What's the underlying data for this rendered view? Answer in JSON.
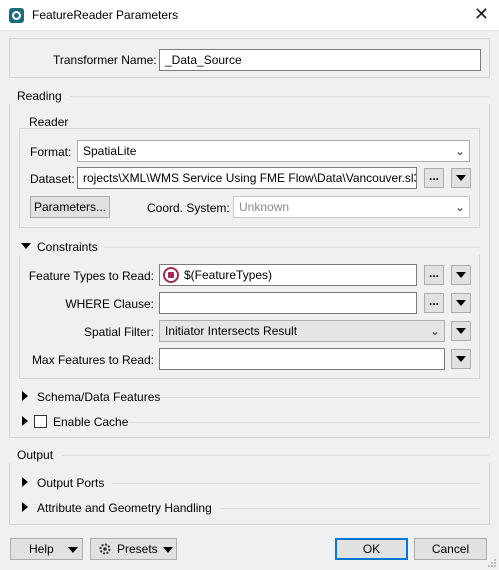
{
  "window": {
    "title": "FeatureReader Parameters",
    "close_glyph": "✕"
  },
  "transformer": {
    "label": "Transformer Name:",
    "value": "_Data_Source"
  },
  "reading": {
    "title": "Reading",
    "reader": {
      "title": "Reader",
      "format_label": "Format:",
      "format_value": "SpatiaLite",
      "dataset_label": "Dataset:",
      "dataset_value": "rojects\\XML\\WMS Service Using FME Flow\\Data\\Vancouver.sl3\"",
      "parameters_button": "Parameters...",
      "coord_label": "Coord. System:",
      "coord_value": "Unknown"
    },
    "constraints": {
      "title": "Constraints",
      "feature_types_label": "Feature Types to Read:",
      "feature_types_value": "$(FeatureTypes)",
      "where_label": "WHERE Clause:",
      "where_value": "",
      "spatial_filter_label": "Spatial Filter:",
      "spatial_filter_value": "Initiator Intersects Result",
      "max_features_label": "Max Features to Read:",
      "max_features_value": ""
    },
    "schema_title": "Schema/Data Features",
    "enable_cache_label": "Enable Cache"
  },
  "output": {
    "title": "Output",
    "ports_title": "Output Ports",
    "attr_geom_title": "Attribute and Geometry Handling"
  },
  "footer": {
    "help_label": "Help",
    "presets_label": "Presets",
    "ok_label": "OK",
    "cancel_label": "Cancel"
  },
  "glyphs": {
    "ellipsis": "...",
    "chevron": "⌄"
  },
  "colors": {
    "accent": "#0078d7",
    "icon_teal": "#1b6b7a",
    "feature_icon": "#9c2b55"
  }
}
